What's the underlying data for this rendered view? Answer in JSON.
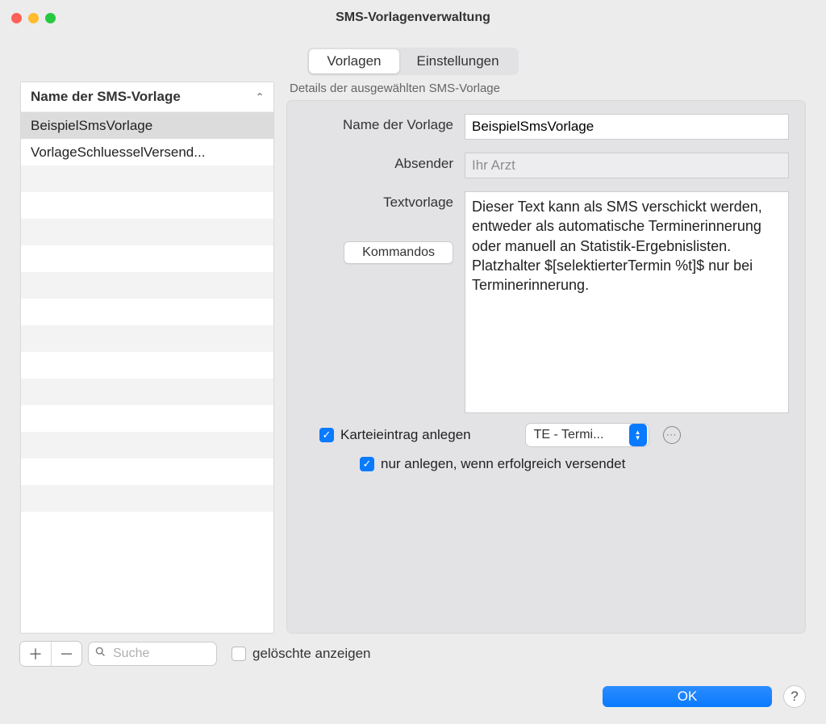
{
  "window": {
    "title": "SMS-Vorlagenverwaltung"
  },
  "tabs": {
    "vorlagen": "Vorlagen",
    "einstellungen": "Einstellungen"
  },
  "list": {
    "header": "Name der SMS-Vorlage",
    "items": [
      "BeispielSmsVorlage",
      "VorlageSchluesselVersend..."
    ]
  },
  "search": {
    "placeholder": "Suche"
  },
  "details": {
    "section_title": "Details der ausgewählten SMS-Vorlage",
    "name_label": "Name der Vorlage",
    "name_value": "BeispielSmsVorlage",
    "sender_label": "Absender",
    "sender_value": "Ihr Arzt",
    "text_label": "Textvorlage",
    "text_value": "Dieser Text kann als SMS verschickt werden, entweder als automatische Terminerinnerung oder manuell an Statistik-Ergebnislisten. Platzhalter $[selektierterTermin %t]$ nur bei Terminerinnerung.",
    "kommandos_btn": "Kommandos"
  },
  "checks": {
    "anlegen": "Karteieintrag anlegen",
    "popup_value": "TE - Termi...",
    "nur_anlegen": "nur anlegen, wenn erfolgreich versendet"
  },
  "bottom": {
    "show_deleted": "gelöschte anzeigen"
  },
  "footer": {
    "ok": "OK",
    "help": "?"
  }
}
